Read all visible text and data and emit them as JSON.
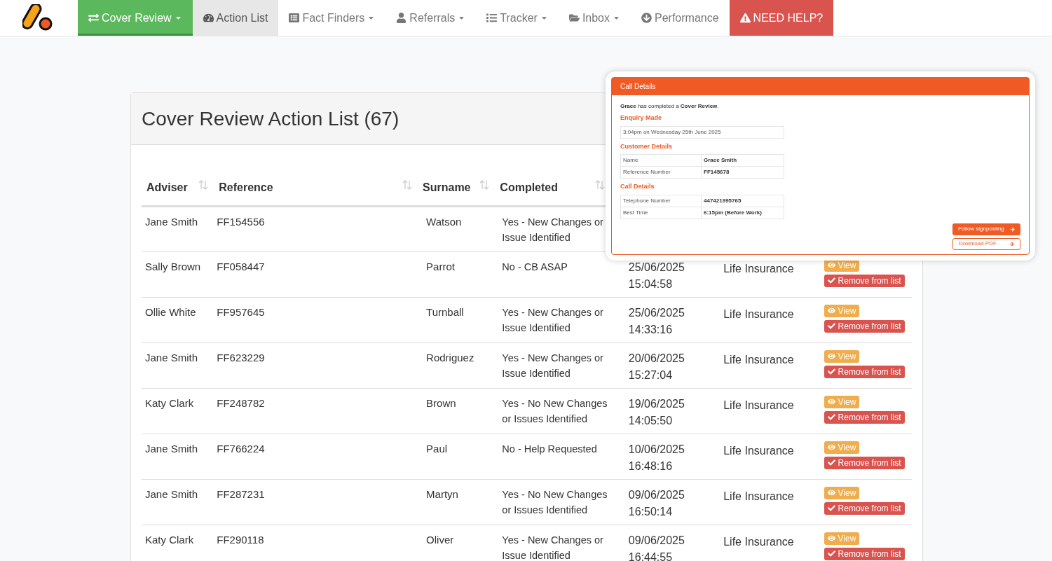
{
  "nav": {
    "items": [
      {
        "label": "Cover Review",
        "dropdown": true,
        "selected": true,
        "kind": "primary"
      },
      {
        "label": "Action List",
        "dropdown": false,
        "selected": false,
        "kind": "current"
      },
      {
        "label": "Fact Finders",
        "dropdown": true,
        "selected": false,
        "kind": "normal"
      },
      {
        "label": "Referrals",
        "dropdown": true,
        "selected": false,
        "kind": "normal"
      },
      {
        "label": "Tracker",
        "dropdown": true,
        "selected": false,
        "kind": "normal"
      },
      {
        "label": "Inbox",
        "dropdown": true,
        "selected": false,
        "kind": "normal"
      },
      {
        "label": "Performance",
        "dropdown": false,
        "selected": false,
        "kind": "normal"
      },
      {
        "label": "NEED HELP?",
        "dropdown": false,
        "selected": false,
        "kind": "alert"
      }
    ]
  },
  "panel": {
    "title": "Cover Review Action List (67)"
  },
  "table": {
    "columns": [
      {
        "label": "Adviser",
        "sortable": true
      },
      {
        "label": "Reference",
        "sortable": true
      },
      {
        "label": "Surname",
        "sortable": true
      },
      {
        "label": "Completed",
        "sortable": true
      }
    ],
    "rows": [
      {
        "adviser": "Jane Smith",
        "reference": "FF154556",
        "surname": "Watson",
        "completed": "Yes - New Changes or Issue Identified"
      },
      {
        "adviser": "Sally Brown",
        "reference": "FF058447",
        "surname": "Parrot",
        "completed": "No - CB ASAP",
        "date": "25/06/2025",
        "time": "15:04:58",
        "type": "Life Insurance",
        "actions": [
          "View",
          "Remove from list"
        ]
      },
      {
        "adviser": "Ollie White",
        "reference": "FF957645",
        "surname": "Turnball",
        "completed": "Yes - New Changes or Issue Identified",
        "date": "25/06/2025",
        "time": "14:33:16",
        "type": "Life Insurance",
        "actions": [
          "View",
          "Remove from list"
        ]
      },
      {
        "adviser": "Jane Smith",
        "reference": "FF623229",
        "surname": "Rodriguez",
        "completed": "Yes - New Changes or Issue Identified",
        "date": "20/06/2025",
        "time": "15:27:04",
        "type": "Life Insurance",
        "actions": [
          "View",
          "Remove from list"
        ]
      },
      {
        "adviser": "Katy Clark",
        "reference": "FF248782",
        "surname": "Brown",
        "completed": "Yes - No New Changes or Issues Identified",
        "date": "19/06/2025",
        "time": "14:05:50",
        "type": "Life Insurance",
        "actions": [
          "View",
          "Remove from list"
        ]
      },
      {
        "adviser": "Jane Smith",
        "reference": "FF766224",
        "surname": "Paul",
        "completed": "No - Help Requested",
        "date": "10/06/2025",
        "time": "16:48:16",
        "type": "Life Insurance",
        "actions": [
          "View",
          "Remove from list"
        ]
      },
      {
        "adviser": "Jane Smith",
        "reference": "FF287231",
        "surname": "Martyn",
        "completed": "Yes - No New Changes or Issues Identified",
        "date": "09/06/2025",
        "time": "16:50:14",
        "type": "Life Insurance",
        "actions": [
          "View",
          "Remove from list"
        ]
      },
      {
        "adviser": "Katy Clark",
        "reference": "FF290118",
        "surname": "Oliver",
        "completed": "Yes - New Changes or Issue Identified",
        "date": "09/06/2025",
        "time": "16:44:55",
        "type": "Life Insurance",
        "actions": [
          "View",
          "Remove from list"
        ]
      }
    ]
  },
  "call_card": {
    "title": "Call Details",
    "intro": "**Grace** has completed a **Cover Review**.",
    "sections": [
      {
        "heading": "Enquiry Made",
        "rows": [
          {
            "value": "3:04pm on Wednesday 25th June 2025"
          }
        ]
      },
      {
        "heading": "Customer Details",
        "rows": [
          {
            "label": "Name",
            "value": "Grace Smith"
          },
          {
            "label": "Reference Number",
            "value": "FF145678"
          }
        ]
      },
      {
        "heading": "Call Details",
        "rows": [
          {
            "label": "Telephone Number",
            "value": "447421995765"
          },
          {
            "label": "Best Time",
            "value": "6:15pm (Before Work)"
          }
        ]
      }
    ],
    "buttons": [
      {
        "label": "Follow signposting",
        "kind": "solid"
      },
      {
        "label": "Download PDF",
        "kind": "outline"
      }
    ]
  }
}
